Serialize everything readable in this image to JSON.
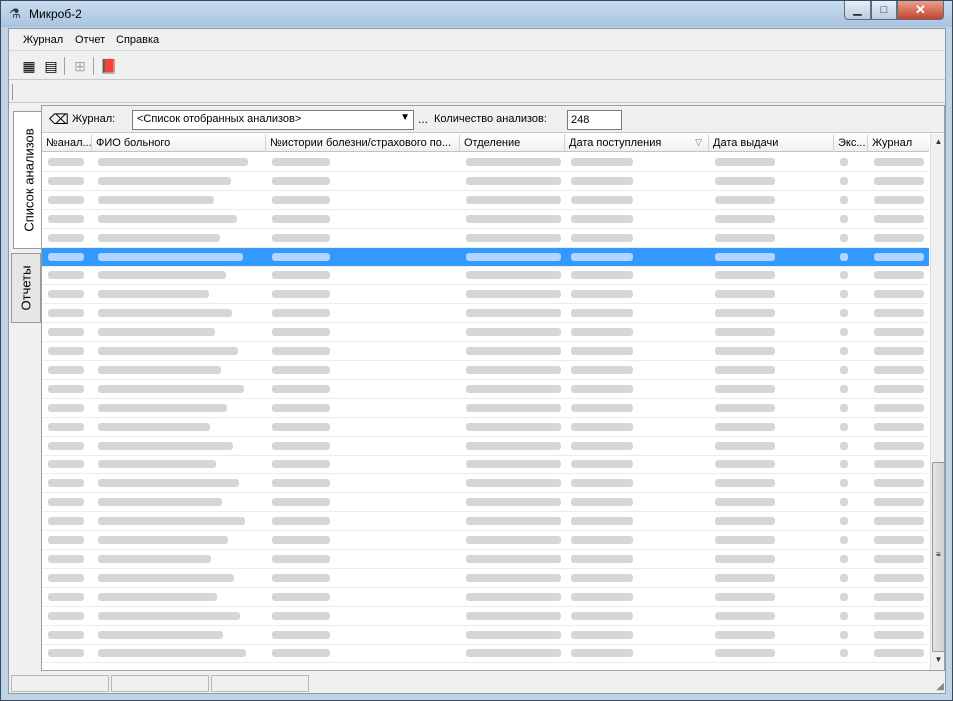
{
  "window": {
    "title": "Микроб-2",
    "close_glyph": "✕",
    "min_glyph": "▁",
    "max_glyph": "□"
  },
  "menu": {
    "items": [
      "Журнал",
      "Отчет",
      "Справка"
    ]
  },
  "toolbar": {
    "icons": [
      "grid-icon",
      "grid-alt-icon",
      "tree-icon",
      "book-icon"
    ]
  },
  "side_tabs": {
    "list_label": "Список анализов",
    "reports_label": "Отчеты"
  },
  "filter": {
    "journal_label": "Журнал:",
    "journal_value": "<Список отобранных анализов>",
    "dots": "...",
    "count_label": "Количество анализов:",
    "count_value": "248"
  },
  "grid": {
    "columns": [
      "№анал...",
      "ФИО больного",
      "№истории болезни/страхового по...",
      "Отделение",
      "Дата поступления",
      "Дата выдачи",
      "Экс...",
      "Журнал"
    ],
    "row_count": 27,
    "selected_row": 5
  },
  "colors": {
    "selection": "#3399ff",
    "title_bar": "#bfd2e6",
    "close_button": "#c4452d"
  }
}
